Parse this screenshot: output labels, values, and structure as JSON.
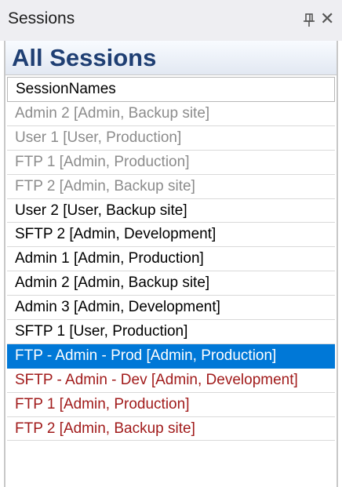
{
  "panel": {
    "title": "Sessions",
    "pin_icon": "pin-icon",
    "close_glyph": "✕"
  },
  "header": {
    "title": "All Sessions"
  },
  "list": {
    "column_header": "SessionNames",
    "rows": [
      {
        "label": "Admin 2 [Admin, Backup site]",
        "state": "inactive"
      },
      {
        "label": "User 1 [User, Production]",
        "state": "inactive"
      },
      {
        "label": "FTP 1 [Admin, Production]",
        "state": "inactive"
      },
      {
        "label": "FTP 2 [Admin, Backup site]",
        "state": "inactive"
      },
      {
        "label": "User 2 [User, Backup site]",
        "state": "normal"
      },
      {
        "label": "SFTP 2 [Admin, Development]",
        "state": "normal"
      },
      {
        "label": "Admin 1 [Admin, Production]",
        "state": "normal"
      },
      {
        "label": "Admin 2 [Admin, Backup site]",
        "state": "normal"
      },
      {
        "label": "Admin 3 [Admin, Development]",
        "state": "normal"
      },
      {
        "label": "SFTP 1 [User, Production]",
        "state": "normal"
      },
      {
        "label": "FTP - Admin - Prod [Admin, Production]",
        "state": "selected"
      },
      {
        "label": "SFTP - Admin - Dev [Admin, Development]",
        "state": "alt"
      },
      {
        "label": "FTP 1 [Admin, Production]",
        "state": "alt"
      },
      {
        "label": "FTP 2 [Admin, Backup site]",
        "state": "alt"
      }
    ]
  },
  "colors": {
    "selected_background": "#0078d7",
    "inactive_text": "#8c8c8c",
    "alt_text": "#a11b1b",
    "heading_text": "#1f3f73"
  }
}
